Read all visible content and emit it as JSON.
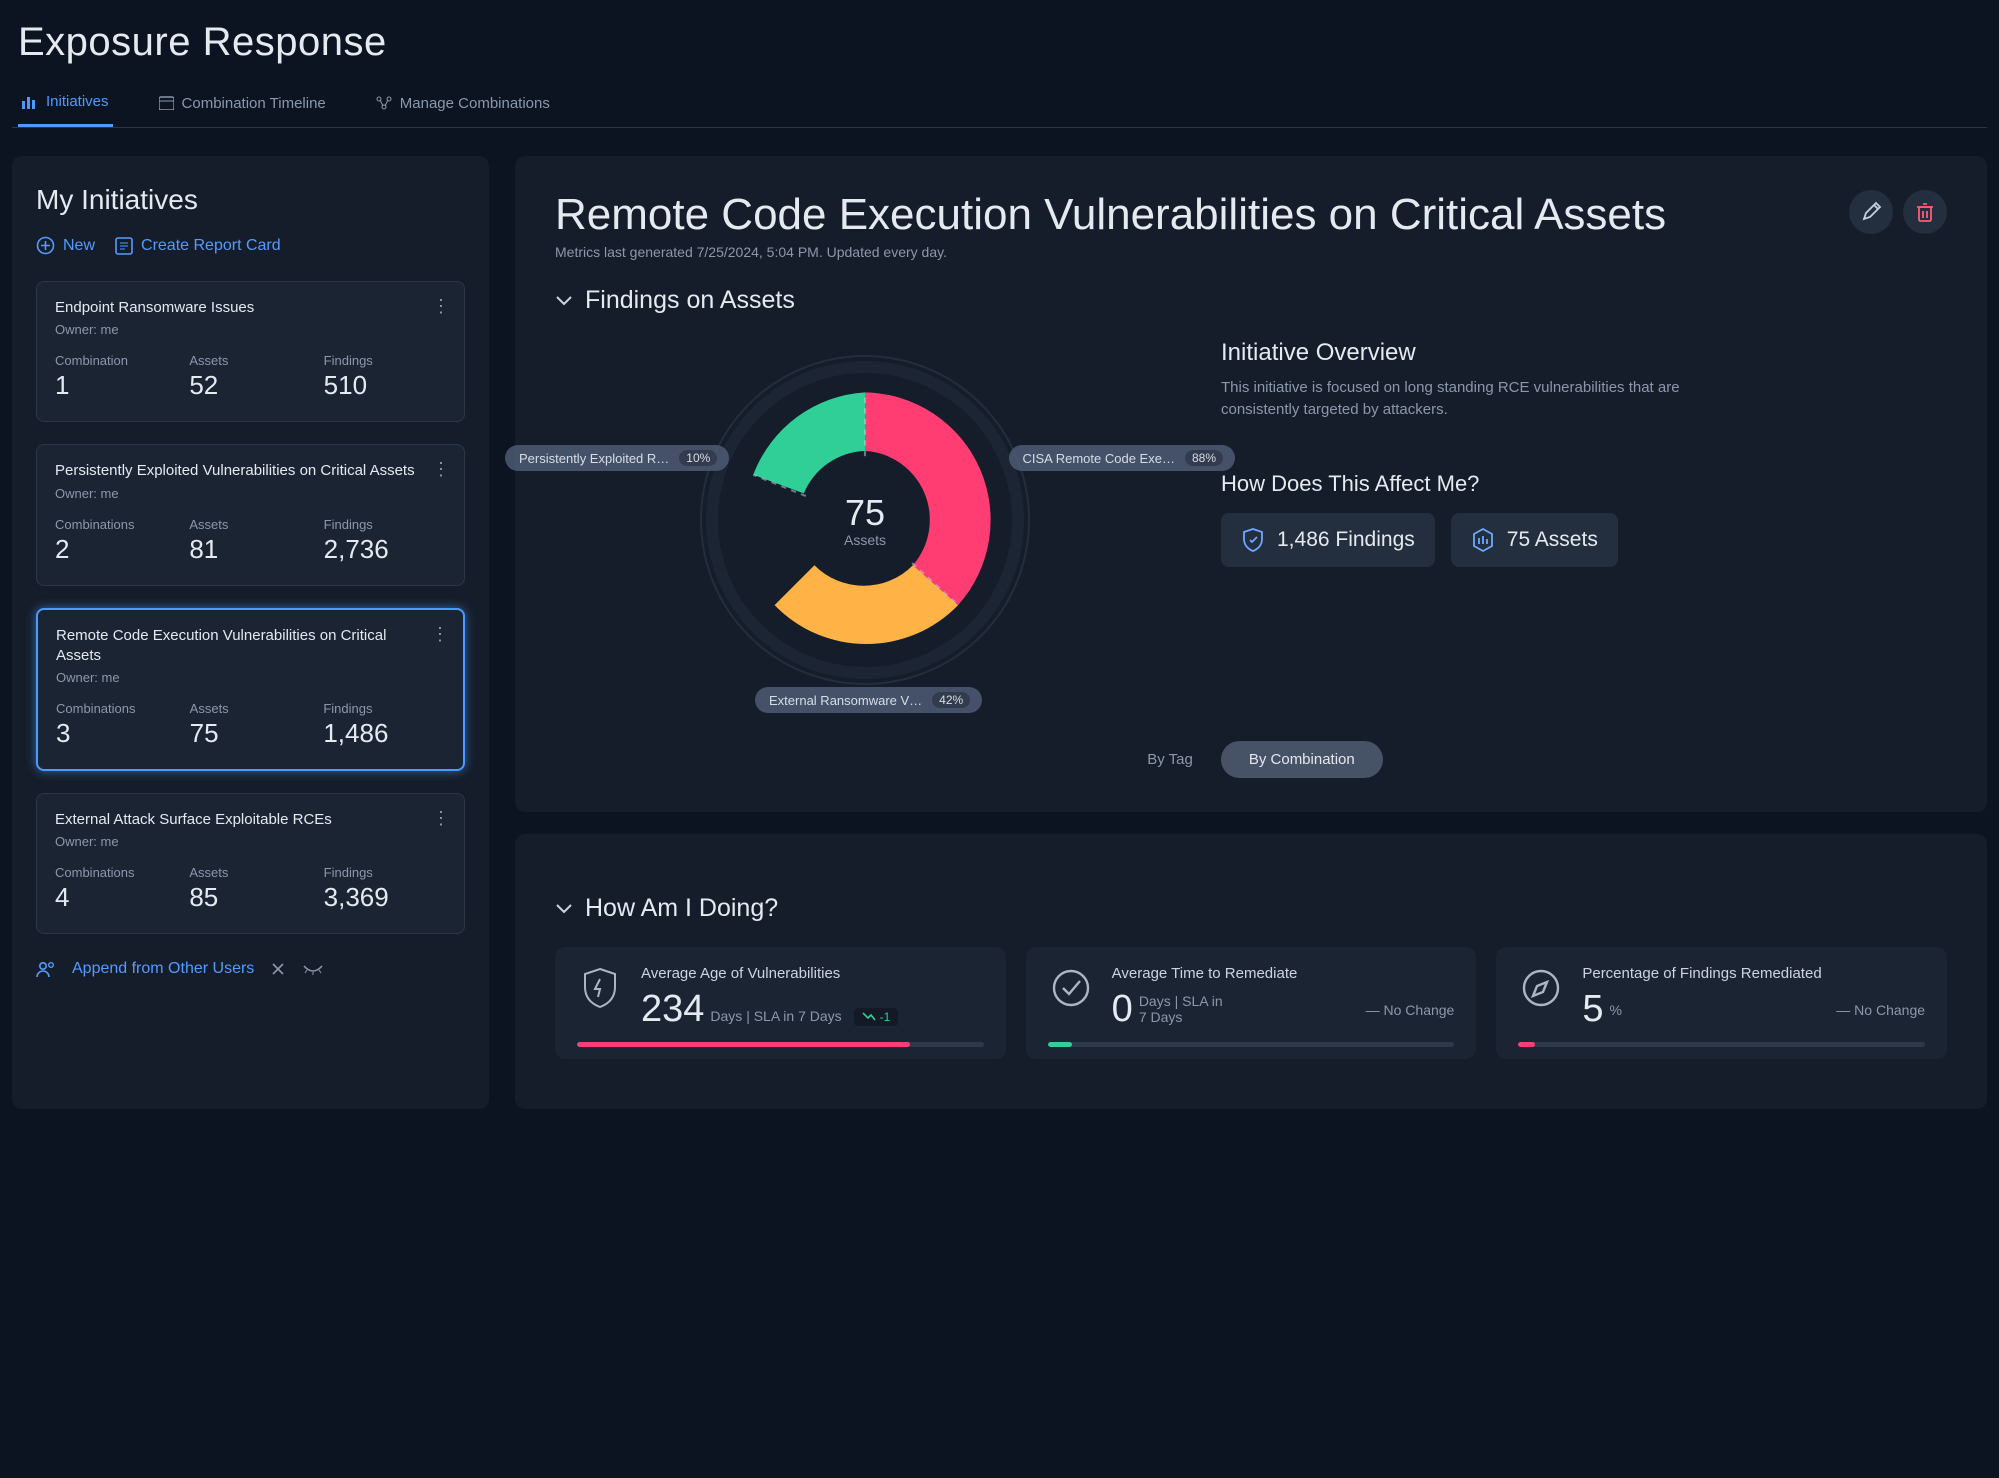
{
  "page_title": "Exposure Response",
  "tabs": [
    {
      "label": "Initiatives",
      "active": true
    },
    {
      "label": "Combination Timeline",
      "active": false
    },
    {
      "label": "Manage Combinations",
      "active": false
    }
  ],
  "sidebar": {
    "title": "My Initiatives",
    "new_label": "New",
    "report_label": "Create Report Card",
    "append_label": "Append from Other Users",
    "cards": [
      {
        "title": "Endpoint Ransomware Issues",
        "owner": "Owner: me",
        "k1": "Combination",
        "v1": "1",
        "k2": "Assets",
        "v2": "52",
        "k3": "Findings",
        "v3": "510",
        "selected": false
      },
      {
        "title": "Persistently Exploited Vulnerabilities on Critical Assets",
        "owner": "Owner: me",
        "k1": "Combinations",
        "v1": "2",
        "k2": "Assets",
        "v2": "81",
        "k3": "Findings",
        "v3": "2,736",
        "selected": false
      },
      {
        "title": "Remote Code Execution Vulnerabilities on Critical Assets",
        "owner": "Owner: me",
        "k1": "Combinations",
        "v1": "3",
        "k2": "Assets",
        "v2": "75",
        "k3": "Findings",
        "v3": "1,486",
        "selected": true
      },
      {
        "title": "External Attack Surface Exploitable RCEs",
        "owner": "Owner: me",
        "k1": "Combinations",
        "v1": "4",
        "k2": "Assets",
        "v2": "85",
        "k3": "Findings",
        "v3": "3,369",
        "selected": false
      }
    ]
  },
  "detail": {
    "title": "Remote Code Execution Vulnerabilities on Critical Assets",
    "subtitle": "Metrics last generated 7/25/2024, 5:04 PM. Updated every day.",
    "section1": "Findings on Assets",
    "center_value": "75",
    "center_label": "Assets",
    "overview_title": "Initiative Overview",
    "overview_text": "This initiative is focused on long standing RCE vulnerabilities that are consistently targeted by attackers.",
    "affect_title": "How Does This Affect Me?",
    "findings_pill": "1,486 Findings",
    "assets_pill": "75 Assets",
    "toggle": {
      "a": "By Tag",
      "b": "By Combination"
    },
    "labels": {
      "a": {
        "name": "CISA Remote Code Exe…",
        "pct": "88%"
      },
      "b": {
        "name": "External Ransomware V…",
        "pct": "42%"
      },
      "c": {
        "name": "Persistently Exploited R…",
        "pct": "10%"
      }
    }
  },
  "chart_data": {
    "type": "pie",
    "title": "Findings on Assets by Combination",
    "center": {
      "value": 75,
      "label": "Assets"
    },
    "legend_position": "around",
    "series": [
      {
        "name": "CISA Remote Code Exe…",
        "value": 88,
        "color": "#ff3d72"
      },
      {
        "name": "External Ransomware V…",
        "value": 42,
        "color": "#ffb347"
      },
      {
        "name": "Persistently Exploited R…",
        "value": 10,
        "color": "#2fcf97"
      }
    ],
    "note": "percentages as displayed on labels; slice angles approximate visual proportions"
  },
  "how": {
    "title": "How Am I Doing?",
    "metrics": [
      {
        "title": "Average Age of Vulnerabilities",
        "value": "234",
        "unit": "Days | SLA in 7 Days",
        "delta": "-1",
        "bar_pct": 82,
        "bar_color": "#ff3d72"
      },
      {
        "title": "Average Time to Remediate",
        "value": "0",
        "unit": "Days | SLA in 7 Days",
        "change": "—  No Change",
        "bar_pct": 6,
        "bar_color": "#2fcf97"
      },
      {
        "title": "Percentage of Findings Remediated",
        "value": "5",
        "unit": "%",
        "change": "—  No Change",
        "bar_pct": 4,
        "bar_color": "#ff3d72"
      }
    ]
  }
}
